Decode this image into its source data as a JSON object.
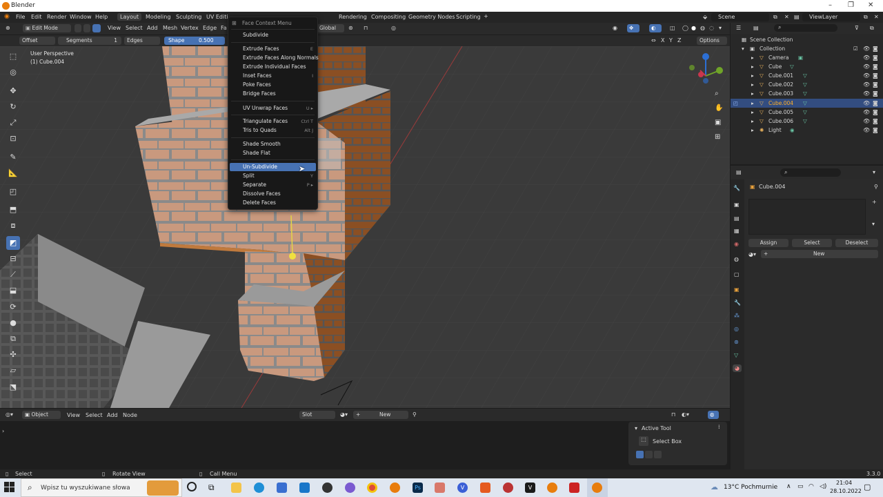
{
  "window": {
    "title": "Blender"
  },
  "menubar": {
    "app_menus": [
      "File",
      "Edit",
      "Render",
      "Window",
      "Help"
    ],
    "workspaces": [
      "Layout",
      "Modeling",
      "Sculpting",
      "UV Editi",
      "Rendering",
      "Compositing",
      "Geometry Nodes",
      "Scripting"
    ],
    "active_workspace": "Layout",
    "add_tab": "+",
    "scene": "Scene",
    "view_layer": "ViewLayer"
  },
  "header": {
    "mode": "Edit Mode",
    "menus": [
      "View",
      "Select",
      "Add",
      "Mesh",
      "Vertex",
      "Edge",
      "Fa"
    ],
    "orientation": "Global",
    "options": "Options",
    "axes": [
      "X",
      "Y",
      "Z"
    ]
  },
  "operator_bar": {
    "offset": "Offset",
    "segments_label": "Segments",
    "segments_value": "1",
    "edges": "Edges",
    "shape_label": "Shape",
    "shape_value": "0.500"
  },
  "viewport": {
    "perspective": "User Perspective",
    "object": "(1) Cube.004"
  },
  "context_menu": {
    "title": "Face Context Menu",
    "items": [
      {
        "label": "Subdivide",
        "shortcut": ""
      },
      {
        "label": "Extrude Faces",
        "shortcut": "E"
      },
      {
        "label": "Extrude Faces Along Normals",
        "shortcut": ""
      },
      {
        "label": "Extrude Individual Faces",
        "shortcut": ""
      },
      {
        "label": "Inset Faces",
        "shortcut": "I"
      },
      {
        "label": "Poke Faces",
        "shortcut": ""
      },
      {
        "label": "Bridge Faces",
        "shortcut": ""
      },
      {
        "label": "UV Unwrap Faces",
        "shortcut": "U ▸"
      },
      {
        "label": "Triangulate Faces",
        "shortcut": "Ctrl T"
      },
      {
        "label": "Tris to Quads",
        "shortcut": "Alt J"
      },
      {
        "label": "Shade Smooth",
        "shortcut": ""
      },
      {
        "label": "Shade Flat",
        "shortcut": ""
      },
      {
        "label": "Un-Subdivide",
        "shortcut": ""
      },
      {
        "label": "Split",
        "shortcut": "Y"
      },
      {
        "label": "Separate",
        "shortcut": "P ▸"
      },
      {
        "label": "Dissolve Faces",
        "shortcut": ""
      },
      {
        "label": "Delete Faces",
        "shortcut": ""
      }
    ],
    "highlighted": "Un-Subdivide"
  },
  "outliner": {
    "root": "Scene Collection",
    "collection": "Collection",
    "items": [
      "Camera",
      "Cube",
      "Cube.001",
      "Cube.002",
      "Cube.003",
      "Cube.004",
      "Cube.005",
      "Cube.006",
      "Light"
    ],
    "selected": "Cube.004"
  },
  "properties": {
    "object_name": "Cube.004",
    "assign": "Assign",
    "select": "Select",
    "deselect": "Deselect",
    "new": "New",
    "plus": "+"
  },
  "timeline": {
    "editor_mode": "Object",
    "menus": [
      "View",
      "Select",
      "Add",
      "Node"
    ],
    "slot": "Slot",
    "new": "New"
  },
  "active_tool": {
    "title": "Active Tool",
    "name": "Select Box"
  },
  "statusbar": {
    "left": "Select",
    "middle": "Rotate View",
    "right": "Call Menu",
    "version": "3.3.0"
  },
  "taskbar": {
    "search_placeholder": "Wpisz tu wyszukiwane słowa",
    "weather": "13°C Pochmurnie",
    "time": "21:04",
    "date": "28.10.2022"
  },
  "colors": {
    "accent": "#4772b3",
    "brick": "#c9997e",
    "mortar": "#7d7d7d",
    "viewport_bg": "#3b3b3b"
  }
}
